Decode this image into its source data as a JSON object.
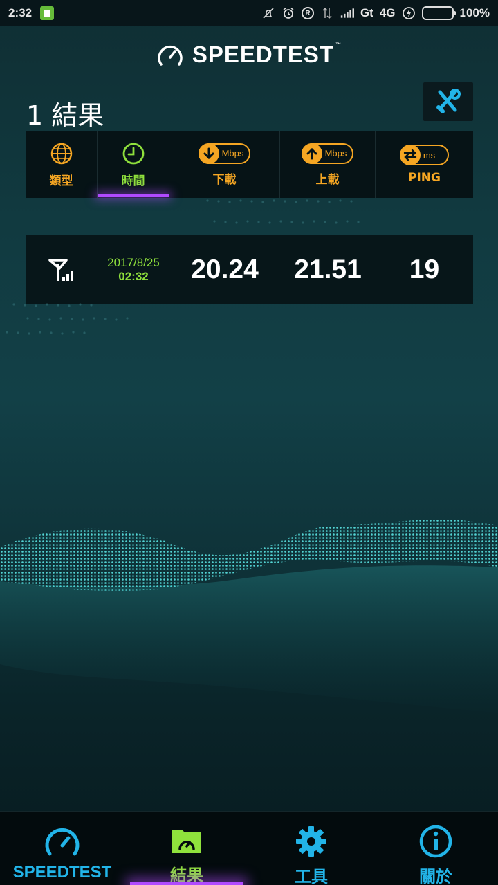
{
  "status_bar": {
    "time": "2:32",
    "carrier": "Gt",
    "network": "4G",
    "battery": "100%",
    "battery_level": 1.0
  },
  "header": {
    "logo_text": "SPEEDTEST",
    "logo_tm": "™",
    "results_count": "1 結果"
  },
  "sort_columns": [
    {
      "label": "類型",
      "icon": "globe-icon",
      "active": false
    },
    {
      "label": "時間",
      "icon": "clock-icon",
      "active": true
    },
    {
      "label": "下載",
      "icon": "download-arrow-icon",
      "unit": "Mbps",
      "active": false
    },
    {
      "label": "上載",
      "icon": "upload-arrow-icon",
      "unit": "Mbps",
      "active": false
    },
    {
      "label": "PING",
      "icon": "ping-arrows-icon",
      "unit": "ms",
      "active": false
    }
  ],
  "results": [
    {
      "type_icon": "cellular-signal-icon",
      "date": "2017/8/25",
      "time": "02:32",
      "download": "20.24",
      "upload": "21.51",
      "ping": "19"
    }
  ],
  "bottom_nav": [
    {
      "label": "SPEEDTEST",
      "icon": "speedometer-icon",
      "active": false
    },
    {
      "label": "結果",
      "icon": "results-folder-icon",
      "active": true
    },
    {
      "label": "工具",
      "icon": "gear-icon",
      "active": false
    },
    {
      "label": "關於",
      "icon": "info-icon",
      "active": false
    }
  ],
  "colors": {
    "accent_orange": "#f5a623",
    "accent_green": "#8fe13c",
    "accent_blue": "#22b4e8",
    "accent_purple": "#b04aff"
  }
}
